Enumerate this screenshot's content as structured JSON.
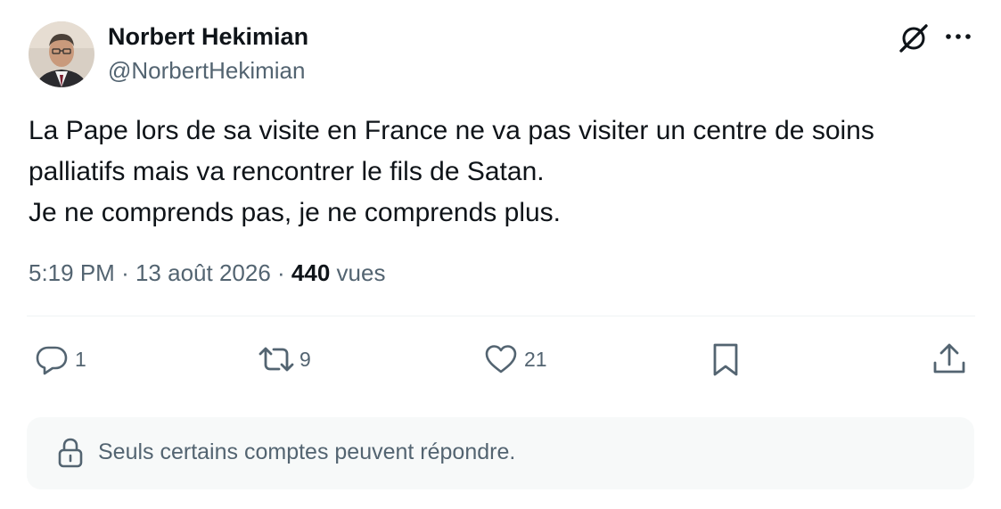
{
  "author": {
    "name": "Norbert Hekimian",
    "handle": "@NorbertHekimian",
    "avatar_icon": "profile-photo"
  },
  "tweet": {
    "lines": [
      "La Pape lors de sa visite en France ne va pas visiter un centre de soins",
      "palliatifs mais va rencontrer le fils de Satan.",
      "Je ne comprends pas, je ne comprends plus."
    ],
    "time": "5:19 PM",
    "separator": "·",
    "date": "13 août 2026",
    "views_count": "440",
    "views_label": "vues"
  },
  "actions": {
    "replies": "1",
    "reposts": "9",
    "likes": "21"
  },
  "reply_restriction": "Seuls certains comptes peuvent répondre.",
  "colors": {
    "text": "#0f1419",
    "secondary": "#536471",
    "notice_bg": "#f7f9f9"
  }
}
